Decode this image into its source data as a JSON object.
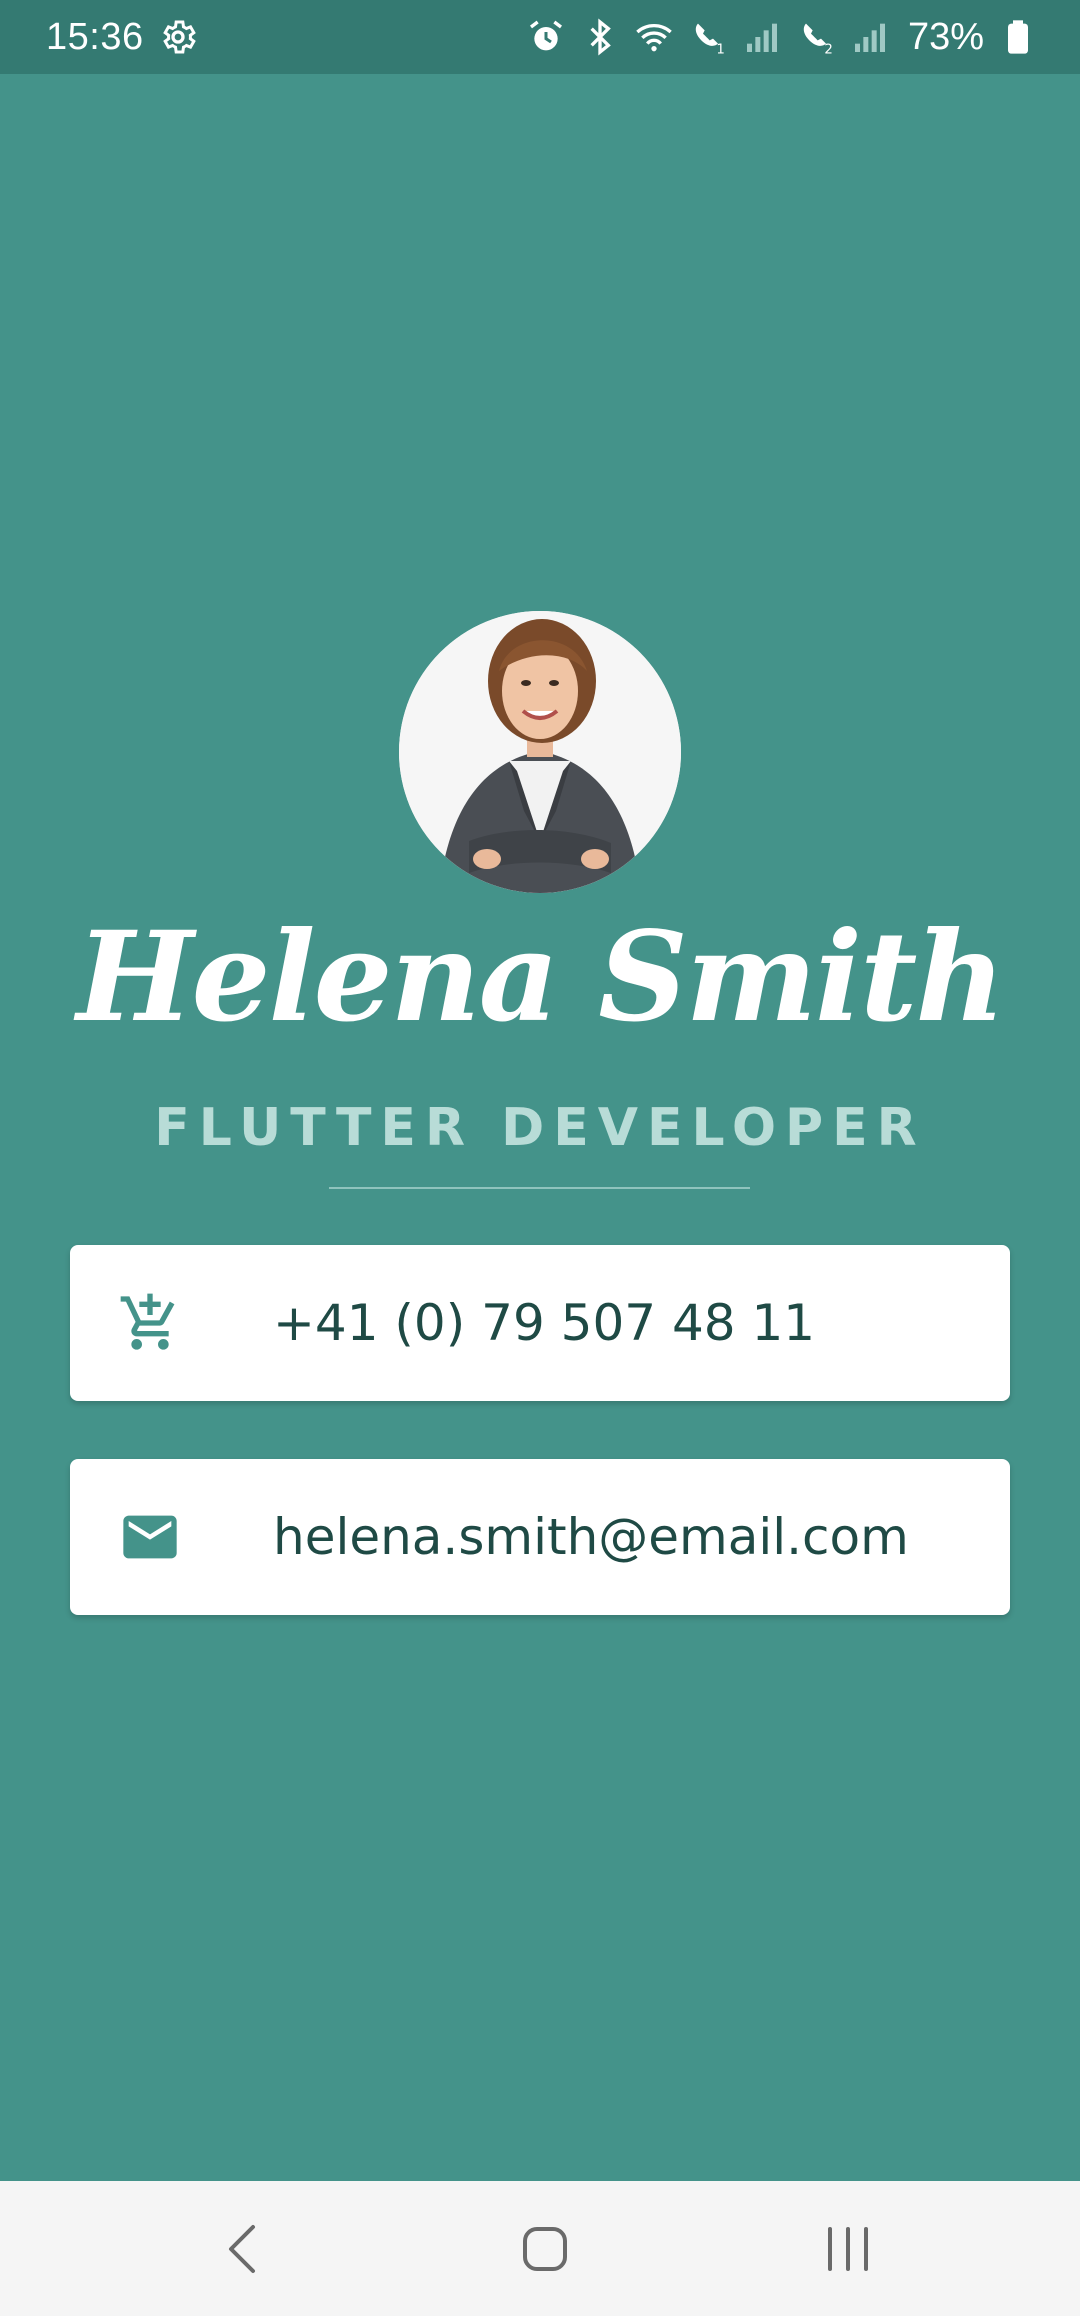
{
  "status_bar": {
    "time": "15:36",
    "battery_percent": "73%",
    "icons": [
      "settings-gear-icon",
      "alarm-icon",
      "bluetooth-icon",
      "wifi-icon",
      "wifi-call-1-icon",
      "signal-1-icon",
      "wifi-call-2-icon",
      "signal-2-icon",
      "battery-icon"
    ]
  },
  "profile": {
    "name": "Helena Smith",
    "title": "FLUTTER DEVELOPER"
  },
  "contacts": {
    "phone": {
      "icon": "add-shopping-cart-icon",
      "value": "+41 (0) 79 507 48 11"
    },
    "email": {
      "icon": "mail-icon",
      "value": "helena.smith@email.com"
    }
  },
  "nav": {
    "icons": [
      "back-icon",
      "home-icon",
      "recents-icon"
    ]
  },
  "colors": {
    "background": "#44938a",
    "status_bar": "#347a72",
    "card": "#ffffff",
    "icon_teal": "#44938a",
    "card_text": "#1f4a45",
    "title": "#b8dcd7",
    "nav_bar": "#f5f5f5"
  }
}
